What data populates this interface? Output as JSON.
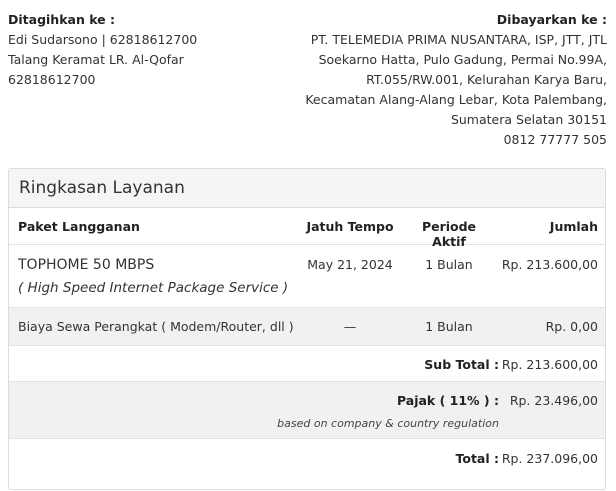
{
  "bill_to": {
    "label": "Ditagihkan ke :",
    "lines": [
      "Edi Sudarsono | 62818612700",
      "Talang Keramat LR. Al-Qofar",
      "62818612700"
    ]
  },
  "pay_to": {
    "label": "Dibayarkan ke :",
    "lines": [
      "PT. TELEMEDIA PRIMA NUSANTARA, ISP, JTT, JTL",
      "Soekarno Hatta, Pulo Gadung, Permai No.99A,",
      "RT.055/RW.001, Kelurahan Karya Baru,",
      "Kecamatan Alang-Alang Lebar, Kota Palembang,",
      "Sumatera Selatan 30151",
      "0812 77777 505"
    ]
  },
  "summary": {
    "title": "Ringkasan Layanan",
    "columns": [
      "Paket Langganan",
      "Jatuh Tempo",
      "Periode Aktif",
      "Jumlah"
    ],
    "items": [
      {
        "name": "TOPHOME 50 MBPS",
        "desc": "( High Speed Internet Package Service )",
        "due": "May 21, 2024",
        "period": "1 Bulan",
        "amount": "Rp. 213.600,00"
      },
      {
        "name": "Biaya Sewa Perangkat ( Modem/Router, dll )",
        "due": "—",
        "period": "1 Bulan",
        "amount": "Rp. 0,00"
      }
    ],
    "subtotal_label": "Sub Total :",
    "subtotal": "Rp. 213.600,00",
    "tax_label": "Pajak ( 11% ) :",
    "tax_note": "based on company & country regulation",
    "tax": "Rp. 23.496,00",
    "total_label": "Total :",
    "total": "Rp. 237.096,00"
  }
}
